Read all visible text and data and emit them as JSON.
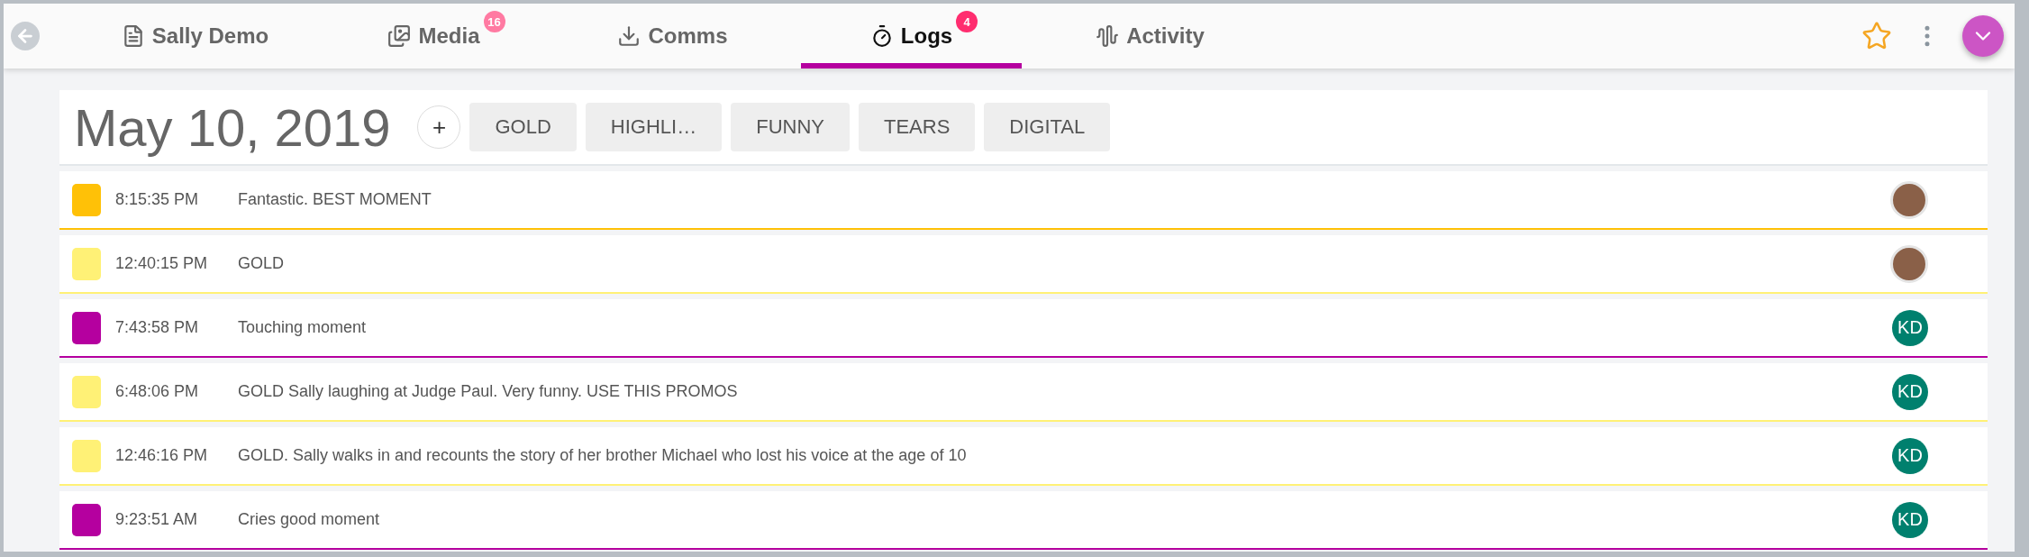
{
  "tabs": [
    {
      "label": "Sally Demo",
      "selected": false
    },
    {
      "label": "Media",
      "badge": "16",
      "selected": false
    },
    {
      "label": "Comms",
      "selected": false
    },
    {
      "label": "Logs",
      "badge": "4",
      "selected": true
    },
    {
      "label": "Activity",
      "selected": false
    }
  ],
  "date": "May 10, 2019",
  "add_button": "+",
  "tags": [
    "GOLD",
    "HIGHLI…",
    "FUNNY",
    "TEARS",
    "DIGITAL"
  ],
  "logs": [
    {
      "color": "#ffc107",
      "time": "8:15:35 PM",
      "text": "Fantastic. BEST MOMENT"
    },
    {
      "color": "#fff176",
      "time": "12:40:15 PM",
      "text": "GOLD"
    },
    {
      "color": "#b5009f",
      "time": "7:43:58 PM",
      "text": "Touching moment",
      "initials": "KD"
    },
    {
      "color": "#fff176",
      "time": "6:48:06 PM",
      "text": "GOLD Sally laughing at Judge Paul. Very funny. USE THIS PROMOS",
      "initials": "KD"
    },
    {
      "color": "#fff176",
      "time": "12:46:16 PM",
      "text": "GOLD. Sally walks in and recounts the story of her brother Michael who lost his voice at the age of 10",
      "initials": "KD"
    },
    {
      "color": "#b5009f",
      "time": "9:23:51 AM",
      "text": "Cries good moment",
      "initials": "KD"
    }
  ]
}
